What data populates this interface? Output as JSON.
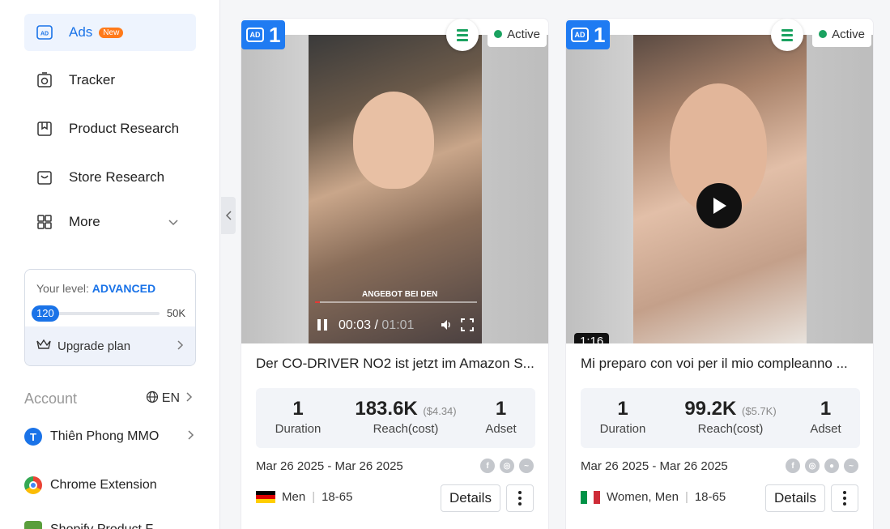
{
  "sidebar": {
    "nav": [
      {
        "label": "Ads",
        "badge": "New",
        "icon": "ad-icon"
      },
      {
        "label": "Tracker",
        "icon": "tracker-icon"
      },
      {
        "label": "Product Research",
        "icon": "bookmark-icon"
      },
      {
        "label": "Store Research",
        "icon": "store-icon"
      },
      {
        "label": "More",
        "icon": "grid-icon"
      }
    ],
    "level": {
      "prefix": "Your level: ",
      "value": "ADVANCED",
      "current": "120",
      "max": "50K",
      "progress_fraction": 0.0024
    },
    "upgrade_label": "Upgrade plan",
    "account_label": "Account",
    "language": "EN",
    "links": [
      {
        "label": "Thiên Phong MMO",
        "icon": "T"
      },
      {
        "label": "Chrome Extension",
        "icon": "chrome-icon"
      },
      {
        "label": "Shopify Product F",
        "icon": "shopify-icon"
      }
    ]
  },
  "cards": [
    {
      "ad_count": "1",
      "status": "Active",
      "title": "Der CO-DRIVER NO2 ist jetzt im Amazon S...",
      "video": {
        "caption": "ANGEBOT BEI DEN",
        "time_current": "00:03",
        "time_sep": " / ",
        "time_total": "01:01"
      },
      "stats": {
        "duration_val": "1",
        "duration_lbl": "Duration",
        "reach_val": "183.6K",
        "reach_cost": "($4.34)",
        "reach_lbl": "Reach(cost)",
        "adset_val": "1",
        "adset_lbl": "Adset"
      },
      "dates": "Mar 26 2025 - Mar 26 2025",
      "audience": "Men",
      "age": "18-65",
      "details_label": "Details"
    },
    {
      "ad_count": "1",
      "status": "Active",
      "title": "Mi preparo con voi per il mio compleanno ...",
      "video": {
        "duration": "1:16"
      },
      "stats": {
        "duration_val": "1",
        "duration_lbl": "Duration",
        "reach_val": "99.2K",
        "reach_cost": "($5.7K)",
        "reach_lbl": "Reach(cost)",
        "adset_val": "1",
        "adset_lbl": "Adset"
      },
      "dates": "Mar 26 2025 - Mar 26 2025",
      "audience": "Women, Men",
      "age": "18-65",
      "details_label": "Details"
    }
  ],
  "colors": {
    "accent": "#1a73e8",
    "active": "#1aa260",
    "badge": "#ff7a1a"
  }
}
